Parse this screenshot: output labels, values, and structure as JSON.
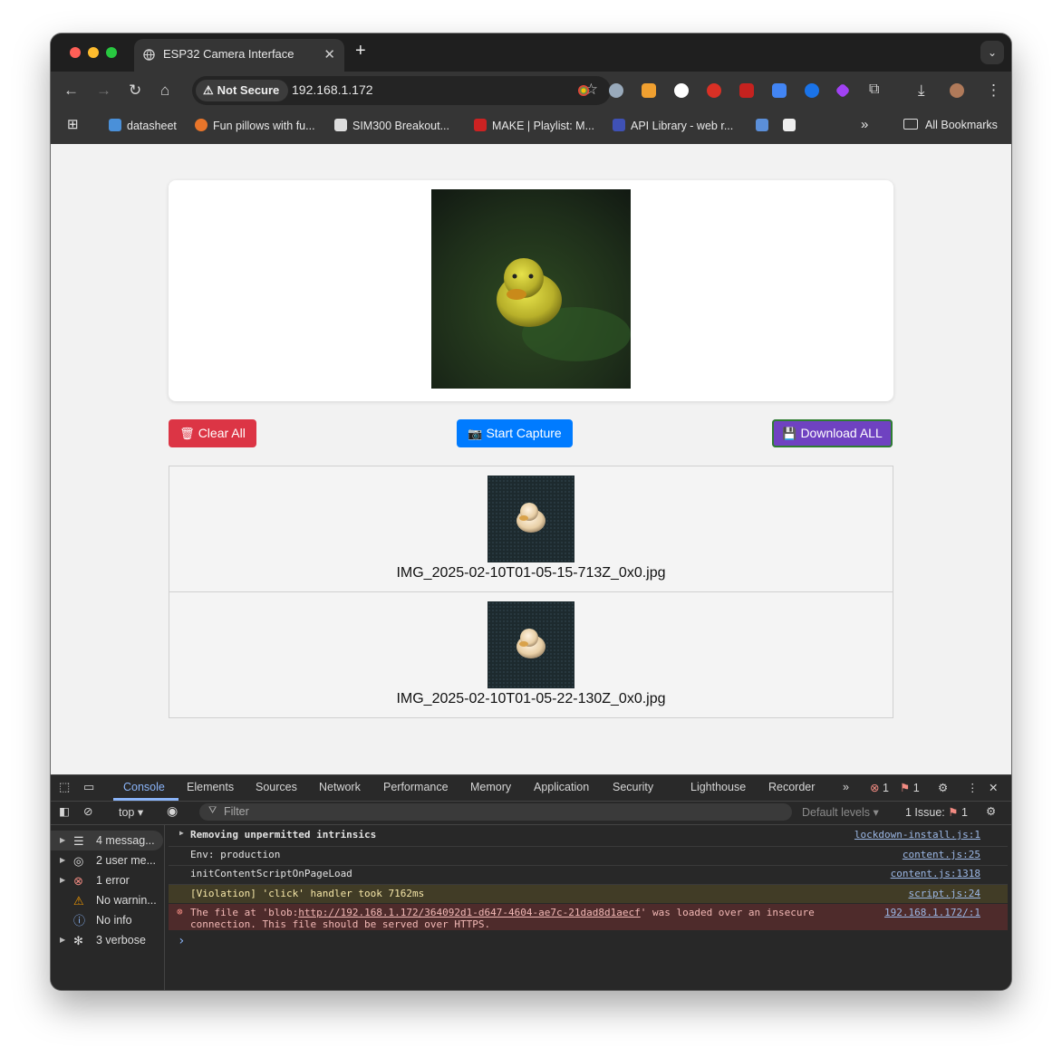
{
  "browser": {
    "tab_title": "ESP32 Camera Interface",
    "tab_close": "✕",
    "new_tab": "+",
    "security_chip": "Not Secure",
    "url": "192.168.1.172",
    "bookmarks": [
      {
        "label": "datasheet",
        "color": "#4a90d9"
      },
      {
        "label": "Fun pillows with fu...",
        "color": "#e8752a"
      },
      {
        "label": "SIM300 Breakout...",
        "color": "#dddddd"
      },
      {
        "label": "MAKE | Playlist: M...",
        "color": "#cc2222"
      },
      {
        "label": "API Library - web r...",
        "color": "#3f51b5"
      }
    ],
    "bookmarks_overflow": "»",
    "all_bookmarks": "All Bookmarks"
  },
  "page": {
    "buttons": {
      "clear": "Clear All",
      "capture": "Start Capture",
      "download": "Download ALL"
    },
    "colors": {
      "clear": "#dc3545",
      "capture": "#007bff",
      "download": "#6f42c1"
    },
    "gallery": [
      {
        "filename": "IMG_2025-02-10T01-05-15-713Z_0x0.jpg"
      },
      {
        "filename": "IMG_2025-02-10T01-05-22-130Z_0x0.jpg"
      }
    ]
  },
  "devtools": {
    "tabs": [
      "Console",
      "Elements",
      "Sources",
      "Network",
      "Performance",
      "Memory",
      "Application",
      "Security",
      "Lighthouse",
      "Recorder"
    ],
    "error_count": "1",
    "issue_count": "1",
    "context": "top",
    "filter_placeholder": "Filter",
    "levels": "Default levels",
    "issues_label": "1 Issue:",
    "issues_num": "1",
    "sidebar": [
      {
        "label": "4 messag...",
        "icon": "list-icon"
      },
      {
        "label": "2 user me...",
        "icon": "user-icon"
      },
      {
        "label": "1 error",
        "icon": "error-icon"
      },
      {
        "label": "No warnin...",
        "icon": "warning-icon"
      },
      {
        "label": "No info",
        "icon": "info-icon"
      },
      {
        "label": "3 verbose",
        "icon": "bug-icon"
      }
    ],
    "logs": [
      {
        "text": "Removing unpermitted intrinsics",
        "source": "lockdown-install.js:1"
      },
      {
        "text": "Env: production",
        "source": "content.js:25"
      },
      {
        "text": "initContentScriptOnPageLoad",
        "source": "content.js:1318"
      },
      {
        "text": "[Violation] 'click' handler took 7162ms",
        "source": "script.js:24"
      },
      {
        "text_before": "The file at 'blob:",
        "link": "http://192.168.1.172/364092d1-d647-4604-ae7c-21dad8d1aecf",
        "text_after": "' was loaded over an insecure",
        "text_line2": "connection. This file should be served over HTTPS.",
        "source": "192.168.1.172/:1"
      }
    ],
    "prompt": "›"
  }
}
